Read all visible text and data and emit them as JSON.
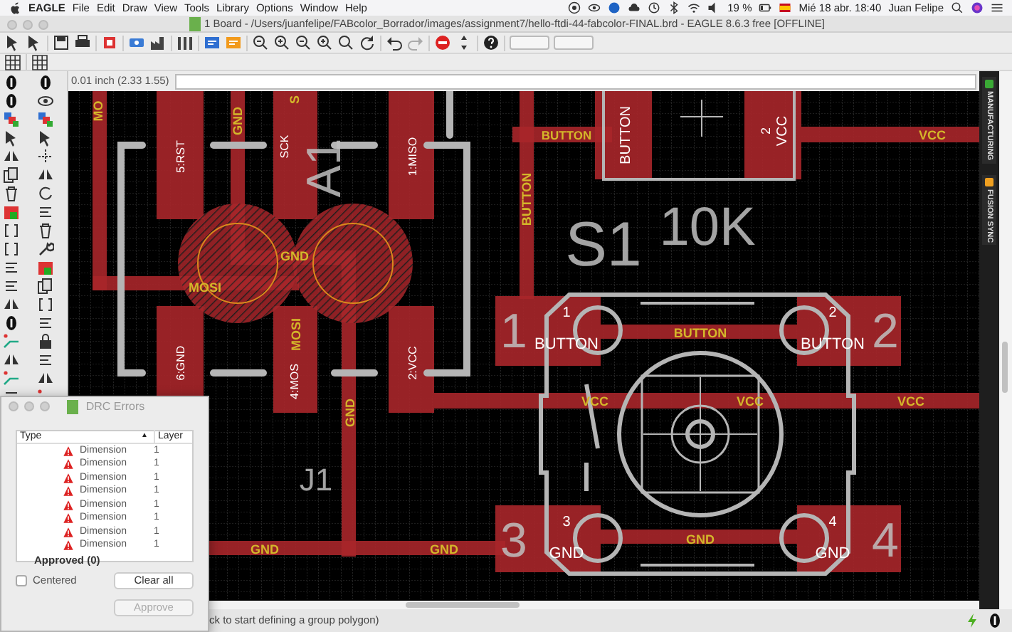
{
  "menubar": {
    "app": "EAGLE",
    "menus": [
      "File",
      "Edit",
      "Draw",
      "View",
      "Tools",
      "Library",
      "Options",
      "Window",
      "Help"
    ],
    "battery": "19 %",
    "clock": "Mié 18 abr.  18:40",
    "user": "Juan Felipe"
  },
  "window": {
    "title": "1 Board - /Users/juanfelipe/FABcolor_Borrador/images/assignment7/hello-ftdi-44-fabcolor-FINAL.brd - EAGLE 8.6.3 free [OFFLINE]"
  },
  "command_bar": {
    "coordinates": "0.01 inch (2.33 1.55)"
  },
  "board": {
    "labels": [
      {
        "text": "MO",
        "kind": "net"
      },
      {
        "text": "GND",
        "kind": "net"
      },
      {
        "text": "S",
        "kind": "net"
      },
      {
        "text": "5:RST",
        "kind": "pad"
      },
      {
        "text": "SCK",
        "kind": "pad"
      },
      {
        "text": "A1",
        "kind": "name"
      },
      {
        "text": "1:MISO",
        "kind": "pad"
      },
      {
        "text": "GND",
        "kind": "net"
      },
      {
        "text": "MOSI",
        "kind": "net"
      },
      {
        "text": "MOSI",
        "kind": "net"
      },
      {
        "text": "6:GND",
        "kind": "pad"
      },
      {
        "text": "4:MOS",
        "kind": "pad"
      },
      {
        "text": "2:VCC",
        "kind": "pad"
      },
      {
        "text": "GND",
        "kind": "net"
      },
      {
        "text": "J1",
        "kind": "name"
      },
      {
        "text": "BUTTON",
        "kind": "net"
      },
      {
        "text": "BUTTON",
        "kind": "net"
      },
      {
        "text": "BUTTON",
        "kind": "pad"
      },
      {
        "text": "2",
        "kind": "pad"
      },
      {
        "text": "VCC",
        "kind": "pad"
      },
      {
        "text": "VCC",
        "kind": "net"
      },
      {
        "text": "S1",
        "kind": "name"
      },
      {
        "text": "10K",
        "kind": "name"
      },
      {
        "text": "1",
        "kind": "name"
      },
      {
        "text": "1",
        "kind": "pad"
      },
      {
        "text": "BUTTON",
        "kind": "pad"
      },
      {
        "text": "BUTTON",
        "kind": "net"
      },
      {
        "text": "2",
        "kind": "pad"
      },
      {
        "text": "BUTTON",
        "kind": "pad"
      },
      {
        "text": "2",
        "kind": "name"
      },
      {
        "text": "VCC",
        "kind": "net"
      },
      {
        "text": "VCC",
        "kind": "net"
      },
      {
        "text": "VCC",
        "kind": "net"
      },
      {
        "text": "GND",
        "kind": "net"
      },
      {
        "text": "GND",
        "kind": "net"
      },
      {
        "text": "3",
        "kind": "name"
      },
      {
        "text": "3",
        "kind": "pad"
      },
      {
        "text": "GND",
        "kind": "pad"
      },
      {
        "text": "GND",
        "kind": "net"
      },
      {
        "text": "4",
        "kind": "pad"
      },
      {
        "text": "GND",
        "kind": "pad"
      },
      {
        "text": "4",
        "kind": "name"
      }
    ]
  },
  "side_tabs": [
    {
      "label": "MANUFACTURING"
    },
    {
      "label": "FUSION SYNC"
    }
  ],
  "drc_dialog": {
    "title": "DRC Errors",
    "columns": [
      "Type",
      "Layer"
    ],
    "sort_indicator": "▲",
    "errors": [
      {
        "type": "Dimension",
        "layer": "1"
      },
      {
        "type": "Dimension",
        "layer": "1"
      },
      {
        "type": "Dimension",
        "layer": "1"
      },
      {
        "type": "Dimension",
        "layer": "1"
      },
      {
        "type": "Dimension",
        "layer": "1"
      },
      {
        "type": "Dimension",
        "layer": "1"
      },
      {
        "type": "Dimension",
        "layer": "1"
      },
      {
        "type": "Dimension",
        "layer": "1"
      }
    ],
    "approved": "Approved (0)",
    "centered": {
      "label": "Centered",
      "checked": false
    },
    "buttons": [
      {
        "label": "Clear all",
        "disabled": false
      },
      {
        "label": "Approve",
        "disabled": true
      }
    ]
  },
  "status_bar": {
    "message": "ck to start defining a group polygon)"
  }
}
